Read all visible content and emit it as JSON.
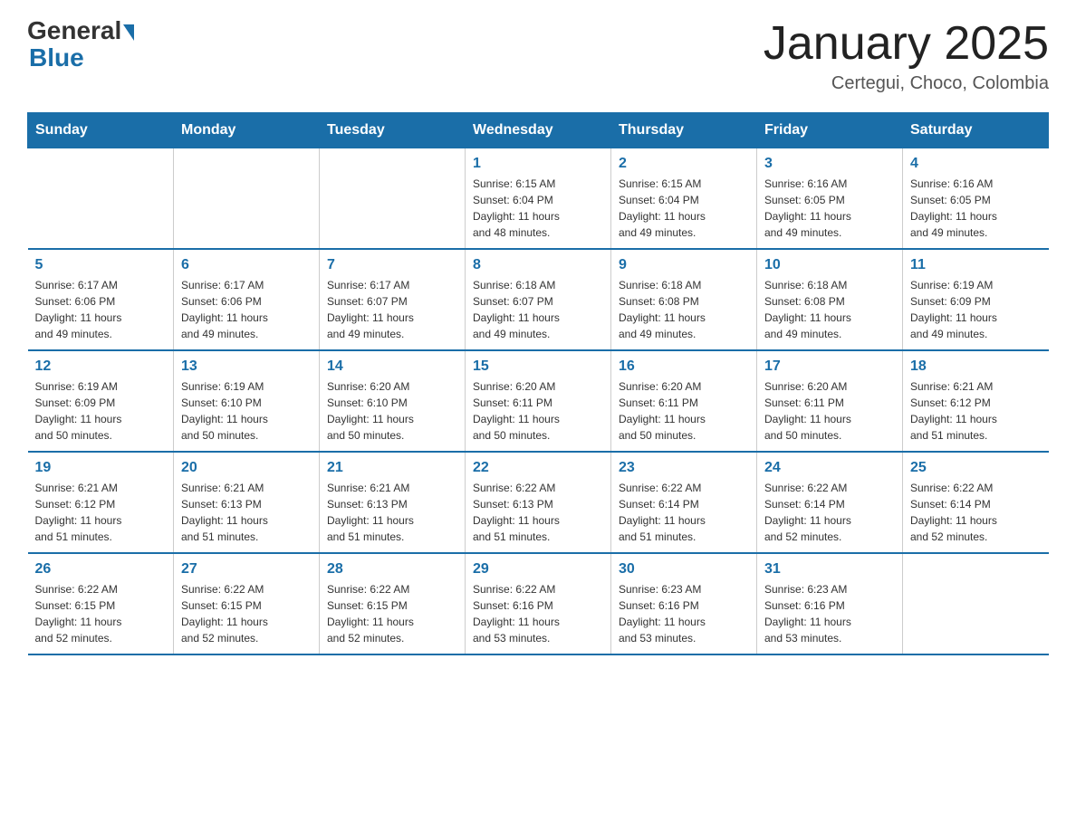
{
  "logo": {
    "general": "General",
    "blue": "Blue"
  },
  "title": "January 2025",
  "location": "Certegui, Choco, Colombia",
  "days_of_week": [
    "Sunday",
    "Monday",
    "Tuesday",
    "Wednesday",
    "Thursday",
    "Friday",
    "Saturday"
  ],
  "weeks": [
    [
      {
        "day": "",
        "info": ""
      },
      {
        "day": "",
        "info": ""
      },
      {
        "day": "",
        "info": ""
      },
      {
        "day": "1",
        "info": "Sunrise: 6:15 AM\nSunset: 6:04 PM\nDaylight: 11 hours\nand 48 minutes."
      },
      {
        "day": "2",
        "info": "Sunrise: 6:15 AM\nSunset: 6:04 PM\nDaylight: 11 hours\nand 49 minutes."
      },
      {
        "day": "3",
        "info": "Sunrise: 6:16 AM\nSunset: 6:05 PM\nDaylight: 11 hours\nand 49 minutes."
      },
      {
        "day": "4",
        "info": "Sunrise: 6:16 AM\nSunset: 6:05 PM\nDaylight: 11 hours\nand 49 minutes."
      }
    ],
    [
      {
        "day": "5",
        "info": "Sunrise: 6:17 AM\nSunset: 6:06 PM\nDaylight: 11 hours\nand 49 minutes."
      },
      {
        "day": "6",
        "info": "Sunrise: 6:17 AM\nSunset: 6:06 PM\nDaylight: 11 hours\nand 49 minutes."
      },
      {
        "day": "7",
        "info": "Sunrise: 6:17 AM\nSunset: 6:07 PM\nDaylight: 11 hours\nand 49 minutes."
      },
      {
        "day": "8",
        "info": "Sunrise: 6:18 AM\nSunset: 6:07 PM\nDaylight: 11 hours\nand 49 minutes."
      },
      {
        "day": "9",
        "info": "Sunrise: 6:18 AM\nSunset: 6:08 PM\nDaylight: 11 hours\nand 49 minutes."
      },
      {
        "day": "10",
        "info": "Sunrise: 6:18 AM\nSunset: 6:08 PM\nDaylight: 11 hours\nand 49 minutes."
      },
      {
        "day": "11",
        "info": "Sunrise: 6:19 AM\nSunset: 6:09 PM\nDaylight: 11 hours\nand 49 minutes."
      }
    ],
    [
      {
        "day": "12",
        "info": "Sunrise: 6:19 AM\nSunset: 6:09 PM\nDaylight: 11 hours\nand 50 minutes."
      },
      {
        "day": "13",
        "info": "Sunrise: 6:19 AM\nSunset: 6:10 PM\nDaylight: 11 hours\nand 50 minutes."
      },
      {
        "day": "14",
        "info": "Sunrise: 6:20 AM\nSunset: 6:10 PM\nDaylight: 11 hours\nand 50 minutes."
      },
      {
        "day": "15",
        "info": "Sunrise: 6:20 AM\nSunset: 6:11 PM\nDaylight: 11 hours\nand 50 minutes."
      },
      {
        "day": "16",
        "info": "Sunrise: 6:20 AM\nSunset: 6:11 PM\nDaylight: 11 hours\nand 50 minutes."
      },
      {
        "day": "17",
        "info": "Sunrise: 6:20 AM\nSunset: 6:11 PM\nDaylight: 11 hours\nand 50 minutes."
      },
      {
        "day": "18",
        "info": "Sunrise: 6:21 AM\nSunset: 6:12 PM\nDaylight: 11 hours\nand 51 minutes."
      }
    ],
    [
      {
        "day": "19",
        "info": "Sunrise: 6:21 AM\nSunset: 6:12 PM\nDaylight: 11 hours\nand 51 minutes."
      },
      {
        "day": "20",
        "info": "Sunrise: 6:21 AM\nSunset: 6:13 PM\nDaylight: 11 hours\nand 51 minutes."
      },
      {
        "day": "21",
        "info": "Sunrise: 6:21 AM\nSunset: 6:13 PM\nDaylight: 11 hours\nand 51 minutes."
      },
      {
        "day": "22",
        "info": "Sunrise: 6:22 AM\nSunset: 6:13 PM\nDaylight: 11 hours\nand 51 minutes."
      },
      {
        "day": "23",
        "info": "Sunrise: 6:22 AM\nSunset: 6:14 PM\nDaylight: 11 hours\nand 51 minutes."
      },
      {
        "day": "24",
        "info": "Sunrise: 6:22 AM\nSunset: 6:14 PM\nDaylight: 11 hours\nand 52 minutes."
      },
      {
        "day": "25",
        "info": "Sunrise: 6:22 AM\nSunset: 6:14 PM\nDaylight: 11 hours\nand 52 minutes."
      }
    ],
    [
      {
        "day": "26",
        "info": "Sunrise: 6:22 AM\nSunset: 6:15 PM\nDaylight: 11 hours\nand 52 minutes."
      },
      {
        "day": "27",
        "info": "Sunrise: 6:22 AM\nSunset: 6:15 PM\nDaylight: 11 hours\nand 52 minutes."
      },
      {
        "day": "28",
        "info": "Sunrise: 6:22 AM\nSunset: 6:15 PM\nDaylight: 11 hours\nand 52 minutes."
      },
      {
        "day": "29",
        "info": "Sunrise: 6:22 AM\nSunset: 6:16 PM\nDaylight: 11 hours\nand 53 minutes."
      },
      {
        "day": "30",
        "info": "Sunrise: 6:23 AM\nSunset: 6:16 PM\nDaylight: 11 hours\nand 53 minutes."
      },
      {
        "day": "31",
        "info": "Sunrise: 6:23 AM\nSunset: 6:16 PM\nDaylight: 11 hours\nand 53 minutes."
      },
      {
        "day": "",
        "info": ""
      }
    ]
  ]
}
